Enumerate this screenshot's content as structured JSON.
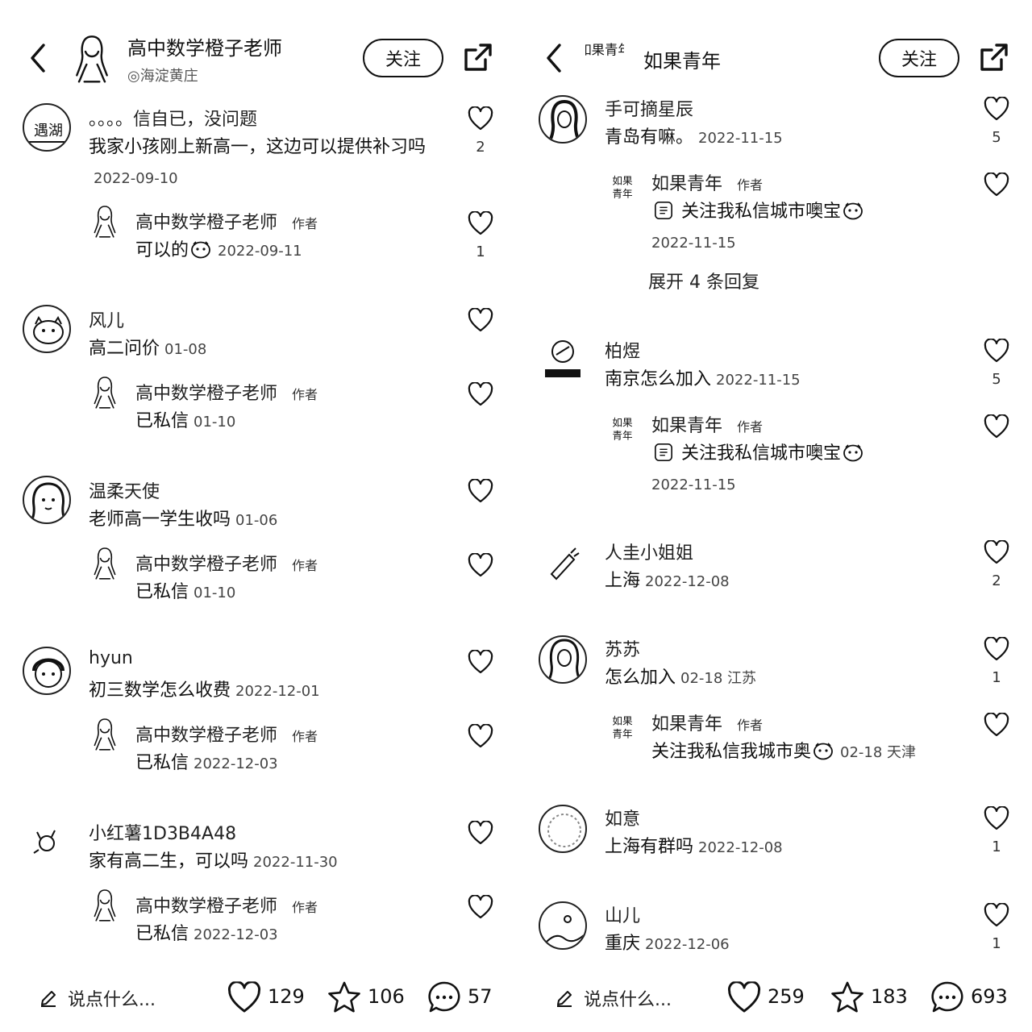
{
  "left": {
    "header": {
      "title": "高中数学橙子老师",
      "subtitle": "◎海淀黄庄",
      "follow_label": "关注"
    },
    "comments": [
      {
        "user": "。。。。信自已，没问题",
        "text": "我家小孩刚上新高一，这边可以提供补习吗",
        "date": "2022-09-10",
        "likes": "2",
        "reply": {
          "user": "高中数学橙子老师",
          "author_tag": "作者",
          "text": "可以的",
          "date": "2022-09-11",
          "likes": "1"
        }
      },
      {
        "user": "风儿",
        "text": "高二问价",
        "date": "01-08",
        "likes": "",
        "reply": {
          "user": "高中数学橙子老师",
          "author_tag": "作者",
          "text": "已私信",
          "date": "01-10",
          "likes": ""
        }
      },
      {
        "user": "温柔天使",
        "text": "老师高一学生收吗",
        "date": "01-06",
        "likes": "",
        "reply": {
          "user": "高中数学橙子老师",
          "author_tag": "作者",
          "text": "已私信",
          "date": "01-10",
          "likes": ""
        }
      },
      {
        "user": "hyun",
        "text": "初三数学怎么收费",
        "date": "2022-12-01",
        "likes": "",
        "reply": {
          "user": "高中数学橙子老师",
          "author_tag": "作者",
          "text": "已私信",
          "date": "2022-12-03",
          "likes": ""
        }
      },
      {
        "user": "小红薯1D3B4A48",
        "text": "家有高二生，可以吗",
        "date": "2022-11-30",
        "likes": "",
        "reply": {
          "user": "高中数学橙子老师",
          "author_tag": "作者",
          "text": "已私信",
          "date": "2022-12-03",
          "likes": ""
        }
      }
    ],
    "bottom": {
      "placeholder": "说点什么...",
      "likes": "129",
      "stars": "106",
      "comments": "57"
    }
  },
  "right": {
    "header": {
      "title": "如果青年",
      "logo_text": "如果青年",
      "follow_label": "关注"
    },
    "comments": [
      {
        "user": "手可摘星辰",
        "text": "青岛有嘛。",
        "date": "2022-11-15",
        "likes": "5",
        "reply": {
          "user": "如果青年",
          "author_tag": "作者",
          "text": "关注我私信城市噢宝",
          "date": "2022-11-15",
          "likes": ""
        },
        "expand": "展开 4 条回复"
      },
      {
        "user": "柏煜",
        "text": "南京怎么加入",
        "date": "2022-11-15",
        "likes": "5",
        "reply": {
          "user": "如果青年",
          "author_tag": "作者",
          "text": "关注我私信城市噢宝",
          "date": "2022-11-15",
          "likes": ""
        }
      },
      {
        "user": "人圭小姐姐",
        "text": "上海",
        "date": "2022-12-08",
        "likes": "2"
      },
      {
        "user": "苏苏",
        "text": "怎么加入",
        "date": "02-18 江苏",
        "likes": "1",
        "reply": {
          "user": "如果青年",
          "author_tag": "作者",
          "text": "关注我私信我城市奥",
          "date": "02-18 天津",
          "likes": ""
        }
      },
      {
        "user": "如意",
        "text": "上海有群吗",
        "date": "2022-12-08",
        "likes": "1"
      },
      {
        "user": "山儿",
        "text": "重庆",
        "date": "2022-12-06",
        "likes": "1"
      }
    ],
    "bottom": {
      "placeholder": "说点什么...",
      "likes": "259",
      "stars": "183",
      "comments": "693"
    }
  },
  "icons": [
    "back-arrow-icon",
    "share-icon",
    "heart-icon",
    "star-icon",
    "comment-bubble-icon",
    "pencil-icon",
    "avatar",
    "emoji-icon"
  ]
}
